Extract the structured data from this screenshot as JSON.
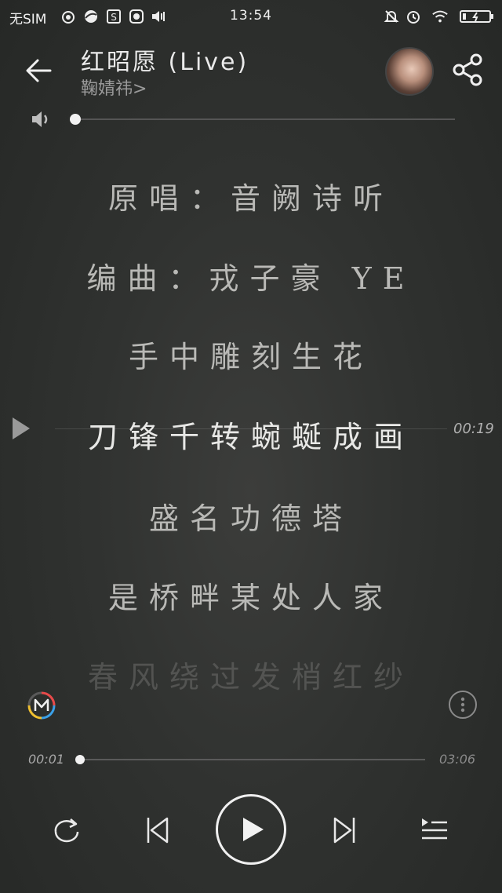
{
  "status_bar": {
    "carrier": "无SIM",
    "time": "13:54"
  },
  "header": {
    "title": "红昭愿 (Live)",
    "artist": "鞠婧祎",
    "artist_chevron": ">"
  },
  "volume": {
    "level": 0.0
  },
  "lyrics": [
    "原唱：音阙诗听",
    "编曲：戎子豪  YE",
    "手中雕刻生花",
    "刀锋千转蜿蜒成画",
    "盛名功德塔",
    "是桥畔某处人家",
    "春风绕过发梢红纱"
  ],
  "lyric_cursor_time": "00:19",
  "playback": {
    "current": "00:01",
    "total": "03:06",
    "progress": 0.005
  },
  "icons": {
    "back": "arrow-left-icon",
    "share": "share-icon",
    "volume": "speaker-icon",
    "repeat": "repeat-icon",
    "prev": "skip-previous-icon",
    "play": "play-icon",
    "next": "skip-next-icon",
    "playlist": "playlist-icon",
    "more": "more-vertical-icon",
    "app": "app-logo-icon"
  },
  "colors": {
    "background": "#2f312f",
    "accent": "#f2f2f2"
  }
}
